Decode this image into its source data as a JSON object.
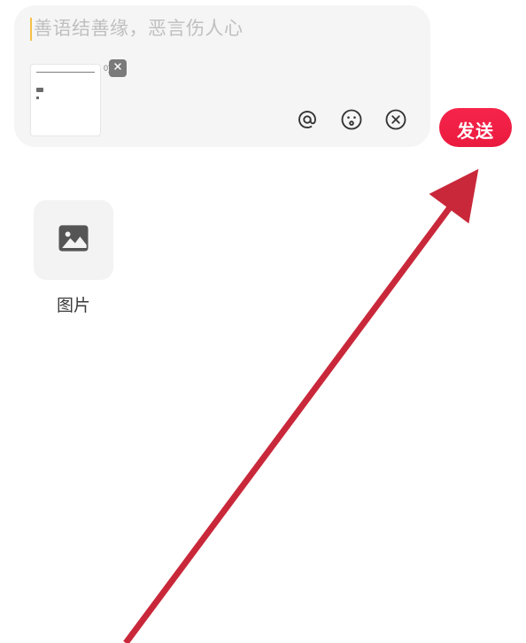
{
  "compose": {
    "placeholder": "善语结善缘，恶言伤人心",
    "attachment_count_badge": "0)"
  },
  "toolbar": {
    "mention_icon": "at-icon",
    "emoji_icon": "emoji-icon",
    "close_icon": "close-circle-icon"
  },
  "send": {
    "label": "发送"
  },
  "options": {
    "image": {
      "label": "图片",
      "icon": "image-icon"
    }
  },
  "colors": {
    "accent": "#f01f44",
    "placeholder": "#bfbfbf",
    "panel": "#f5f5f5",
    "icon": "#333333",
    "cursor": "#f5c046"
  }
}
